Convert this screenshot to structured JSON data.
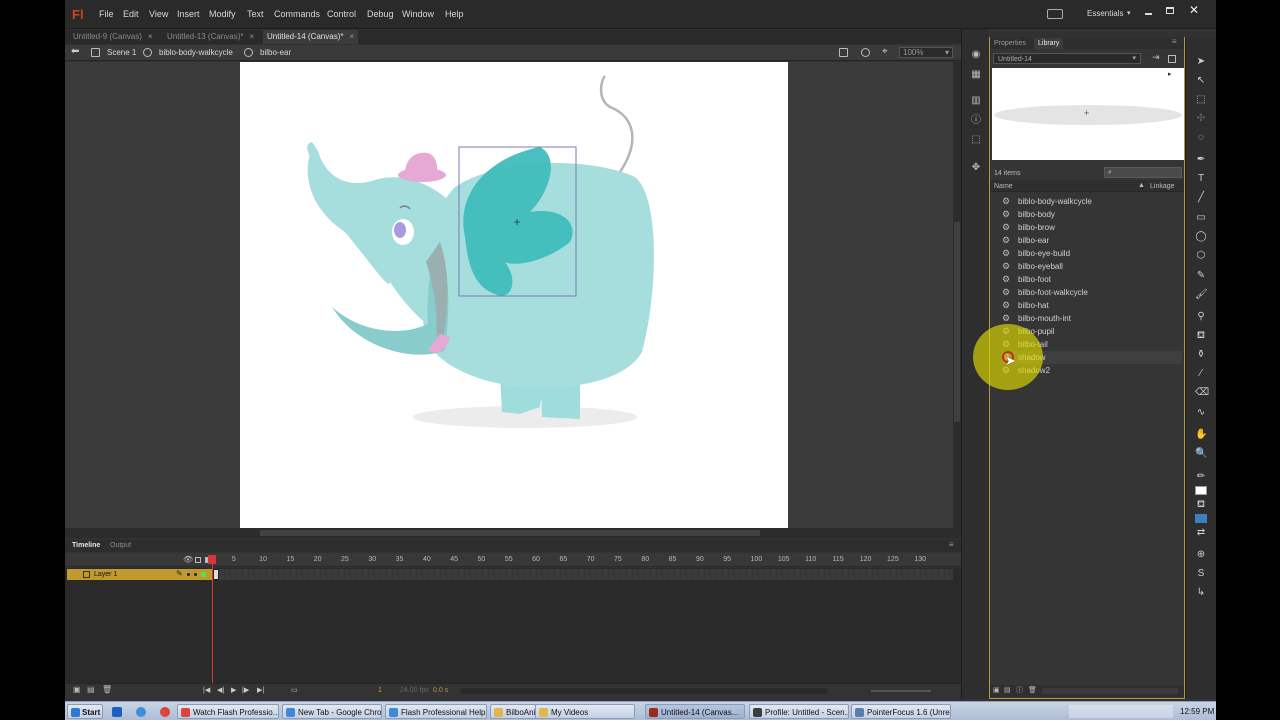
{
  "app": {
    "logo": "Fl",
    "workspace": "Essentials",
    "workspace_arrow": "▾"
  },
  "menu": [
    "File",
    "Edit",
    "View",
    "Insert",
    "Modify",
    "Text",
    "Commands",
    "Control",
    "Debug",
    "Window",
    "Help"
  ],
  "doc_tabs": [
    {
      "label": "Untitled-9 (Canvas)",
      "active": false
    },
    {
      "label": "Untitled-13 (Canvas)*",
      "active": false
    },
    {
      "label": "Untitled-14 (Canvas)*",
      "active": true
    }
  ],
  "breadcrumb": [
    "Scene 1",
    "biblo-body-walkcycle",
    "bilbo-ear"
  ],
  "zoom": "100%",
  "timeline": {
    "tabs": [
      "Timeline",
      "Output"
    ],
    "frame_numbers": [
      "1",
      "5",
      "10",
      "15",
      "20",
      "25",
      "30",
      "35",
      "40",
      "45",
      "50",
      "55",
      "60",
      "65",
      "70",
      "75",
      "80",
      "85",
      "90",
      "95",
      "100",
      "105",
      "110",
      "115",
      "120",
      "125",
      "130"
    ],
    "layer_name": "Layer 1",
    "footer_frame": "1",
    "footer_fps": "24.00 fps",
    "footer_time": "0.0 s"
  },
  "panels": {
    "tabs": [
      "Properties",
      "Library"
    ],
    "active_tab": "Library",
    "library_doc": "Untitled-14",
    "preview_cross": "+",
    "item_count": "14 items",
    "col_name": "Name",
    "col_linkage": "Linkage",
    "items": [
      "biblo-body-walkcycle",
      "bilbo-body",
      "bilbo-brow",
      "bilbo-ear",
      "bilbo-eye-build",
      "bilbo-eyeball",
      "bilbo-foot",
      "bilbo-foot-walkcycle",
      "bilbo-hat",
      "bilbo-mouth-int",
      "bilbo-pupil",
      "bilbo-tail",
      "shadow",
      "shadow2"
    ],
    "selected_item": "shadow"
  },
  "taskbar": {
    "start": "Start",
    "tasks": [
      {
        "label": "Watch Flash Professio...",
        "color": "#d9443b"
      },
      {
        "label": "New Tab - Google Chro...",
        "color": "#3c8ad8"
      },
      {
        "label": "Flash Professional Help...",
        "color": "#3c8ad8"
      },
      {
        "label": "BilboAnimation",
        "color": "#e0b84a"
      },
      {
        "label": "My Videos",
        "color": "#e0b84a"
      },
      {
        "label": "Untitled-14 (Canvas...",
        "color": "#9b2b1c"
      },
      {
        "label": "Profile: Untitled - Scen...",
        "color": "#3c3c3c"
      },
      {
        "label": "PointerFocus 1.6 (Unre...",
        "color": "#5a7db0"
      }
    ],
    "clock": "12:59 PM"
  },
  "colors": {
    "accent_layer": "#c09a2f",
    "playhead": "#d23a3a",
    "body": "#9fdcdc",
    "ear": "#3fbcbc",
    "hat": "#e6a8d4",
    "highlight": "#e8e000"
  }
}
